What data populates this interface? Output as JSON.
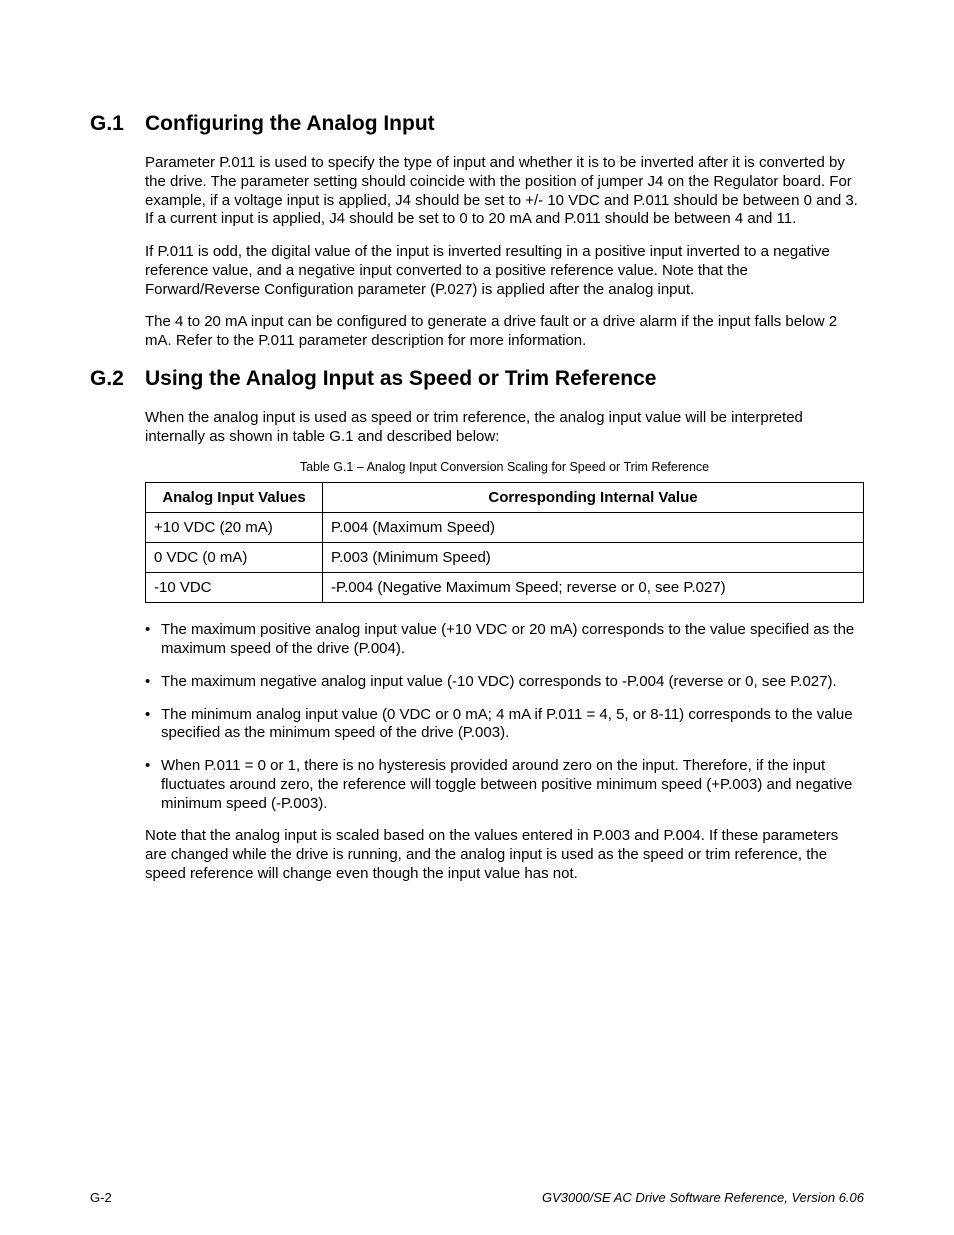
{
  "sections": {
    "g1": {
      "num": "G.1",
      "title": "Configuring the Analog Input",
      "paras": [
        "Parameter P.011 is used to specify the type of input and whether it is to be inverted after it is converted by the drive. The parameter setting should coincide with the position of jumper J4 on the Regulator board. For example, if a voltage input is applied, J4 should be set to +/- 10 VDC and P.011 should be between 0 and 3. If a current input is applied, J4 should be set to 0 to 20 mA and P.011 should be between 4 and 11.",
        "If P.011 is odd, the digital value of the input is inverted resulting in a positive input inverted to a negative reference value, and a negative input converted to a positive reference value. Note that the Forward/Reverse Configuration parameter (P.027) is applied after the analog input.",
        "The 4 to 20 mA input can be configured to generate a drive fault or a drive alarm if the input falls below 2 mA. Refer to the P.011 parameter description for more information."
      ]
    },
    "g2": {
      "num": "G.2",
      "title": "Using the Analog Input as Speed or Trim Reference",
      "intro": "When the analog input is used as speed or trim reference, the analog input value will be interpreted internally as shown in table G.1 and described below:",
      "table_caption": "Table G.1 – Analog Input Conversion Scaling for Speed or Trim Reference",
      "table": {
        "head_a": "Analog Input Values",
        "head_b": "Corresponding Internal Value",
        "rows": [
          {
            "a": "+10 VDC (20 mA)",
            "b": "P.004 (Maximum Speed)"
          },
          {
            "a": "0 VDC (0 mA)",
            "b": "P.003 (Minimum Speed)"
          },
          {
            "a": "-10 VDC",
            "b": "-P.004 (Negative Maximum Speed; reverse or 0, see P.027)"
          }
        ]
      },
      "bullets": [
        "The maximum positive analog input value (+10 VDC or 20 mA) corresponds to the value specified as the maximum speed of the drive (P.004).",
        "The maximum negative analog input value (-10 VDC) corresponds to -P.004 (reverse or 0, see P.027).",
        "The minimum analog input value (0 VDC or 0 mA; 4 mA if P.011 = 4, 5, or 8-11) corresponds to the value specified as the minimum speed of the drive (P.003).",
        "When P.011 = 0 or 1, there is no hysteresis provided around zero on the input. Therefore, if the input fluctuates around zero, the reference will toggle between positive minimum speed (+P.003) and negative minimum speed (-P.003)."
      ],
      "note": "Note that the analog input is scaled based on the values entered in P.003 and P.004. If these parameters are changed while the drive is running, and the analog input is used as the speed or trim reference, the speed reference will change even though the input value has not."
    }
  },
  "footer": {
    "left": "G-2",
    "right": "GV3000/SE AC Drive Software Reference, Version 6.06"
  }
}
